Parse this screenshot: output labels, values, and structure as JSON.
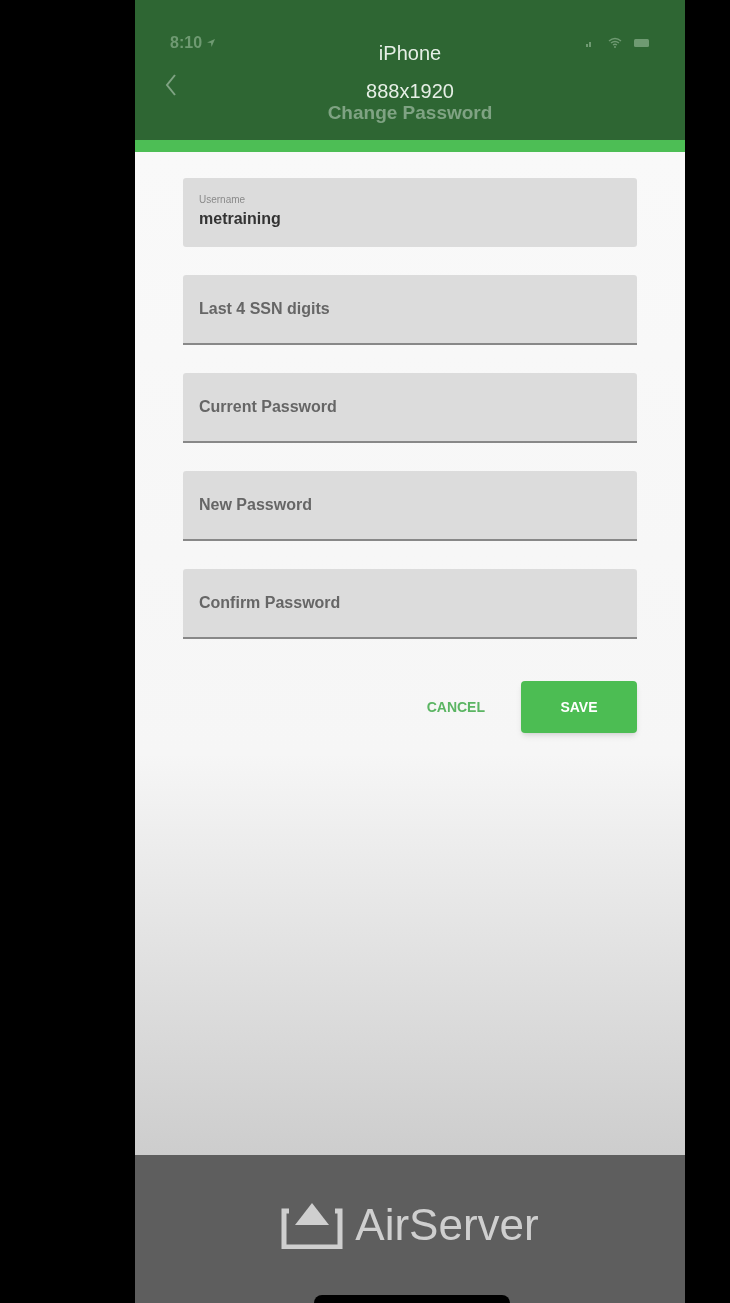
{
  "status_bar": {
    "time": "8:10"
  },
  "mirror_overlay": {
    "device": "iPhone",
    "resolution": "888x1920"
  },
  "nav_bar": {
    "title": "Change Password"
  },
  "fields": [
    {
      "label": "Username",
      "value": "metraining",
      "underlined": false
    },
    {
      "placeholder": "Last 4 SSN digits",
      "underlined": true
    },
    {
      "placeholder": "Current Password",
      "underlined": true
    },
    {
      "placeholder": "New Password",
      "underlined": true
    },
    {
      "placeholder": "Confirm Password",
      "underlined": true
    }
  ],
  "buttons": [
    {
      "label": "CANCEL",
      "kind": "text"
    },
    {
      "label": "SAVE",
      "kind": "filled"
    }
  ],
  "footer": {
    "brand": "AirServer"
  }
}
